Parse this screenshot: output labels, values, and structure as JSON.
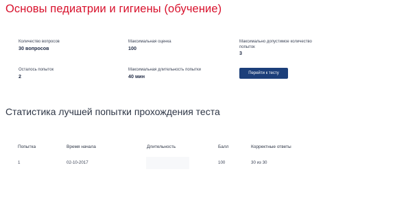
{
  "page": {
    "title": "Основы педиатрии и гигиены (обучение)"
  },
  "stats": {
    "questions_count": {
      "label": "Количество вопросов",
      "value": "30 вопросов"
    },
    "max_score": {
      "label": "Максимальная оценка",
      "value": "100"
    },
    "max_attempts": {
      "label": "Максимально допустимое количество попыток",
      "value": "3"
    },
    "attempts_left": {
      "label": "Осталось попыток",
      "value": "2"
    },
    "max_duration": {
      "label": "Максимальная длительность попытки",
      "value": "40 мин"
    }
  },
  "actions": {
    "start_test_label": "Перейти к тесту"
  },
  "best_attempt": {
    "title": "Статистика лучшей попытки прохождения теста",
    "columns": [
      "Попытка",
      "Время начала",
      "Длительность",
      "Балл",
      "Корректные ответы"
    ],
    "rows": [
      [
        "1",
        "02-10-2017",
        "",
        "100",
        "30 из 30"
      ]
    ]
  },
  "colors": {
    "title_red": "#d8102b",
    "button_blue": "#1c3f7a"
  }
}
